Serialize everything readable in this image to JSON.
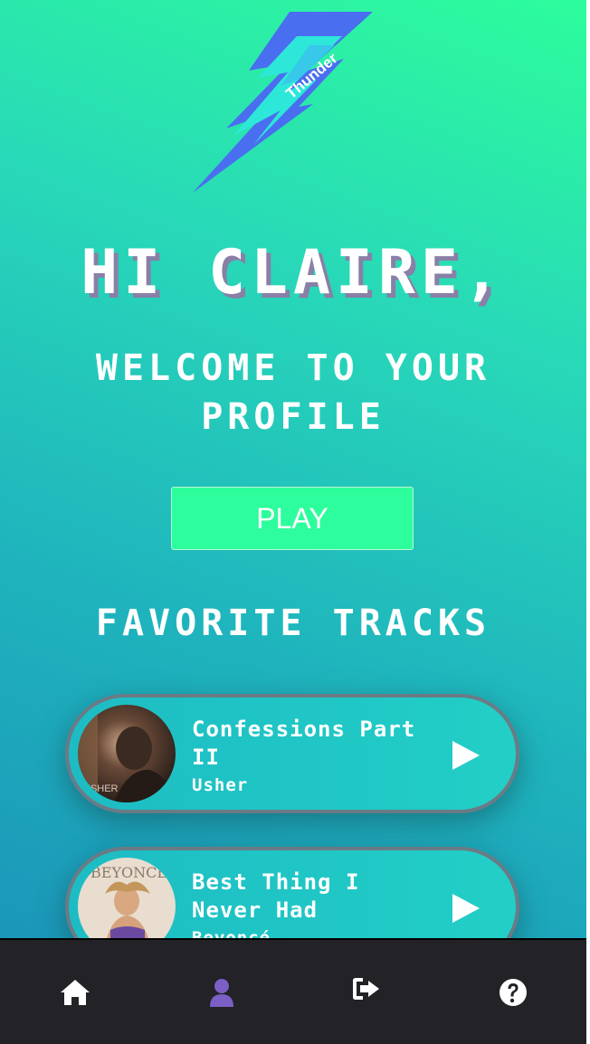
{
  "logo": {
    "text": "Thunder"
  },
  "greeting": "HI CLAIRE,",
  "welcome": "WELCOME TO YOUR PROFILE",
  "play_button": "PLAY",
  "favorites": {
    "title": "FAVORITE TRACKS",
    "tracks": [
      {
        "title": "Confessions Part II",
        "artist": "Usher",
        "art_text": "USHER"
      },
      {
        "title": "Best Thing I Never Had",
        "artist": "Beyoncé",
        "art_text": "BEYONCE"
      }
    ]
  },
  "nav": {
    "items": [
      {
        "icon": "home-icon",
        "active": false
      },
      {
        "icon": "user-icon",
        "active": true
      },
      {
        "icon": "sign-out-icon",
        "active": false
      },
      {
        "icon": "question-circle-icon",
        "active": false
      }
    ]
  },
  "colors": {
    "accent_green": "#2dfd9c",
    "nav_background": "#222227",
    "active_nav": "#7b5fc4",
    "logo_blue": "#4a6ef0",
    "logo_cyan": "#2de8d8"
  }
}
